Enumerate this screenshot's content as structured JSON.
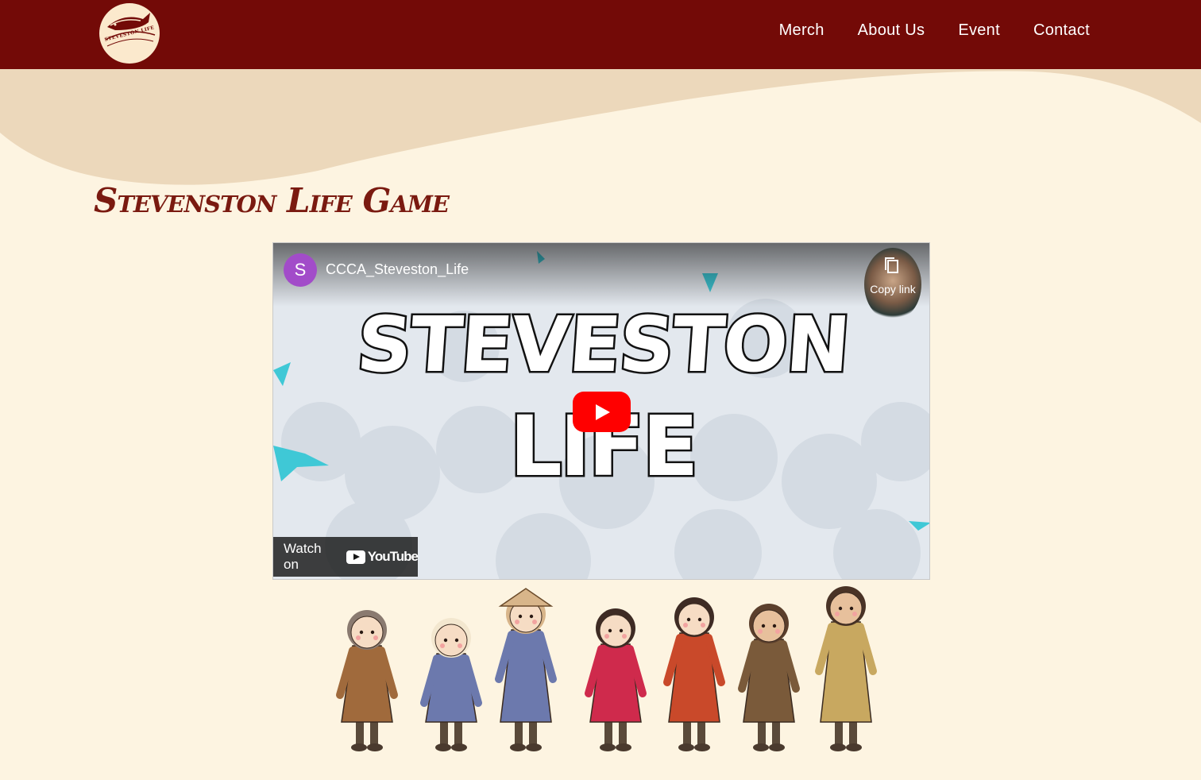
{
  "header": {
    "logo_text": "STEVESTON LIFE",
    "nav": [
      "Merch",
      "About Us",
      "Event",
      "Contact"
    ]
  },
  "page": {
    "title": "Stevenston Life Game"
  },
  "video": {
    "channel_initial": "S",
    "channel_name": "CCCA_Steveston_Life",
    "copy_link_label": "Copy link",
    "title_line1": "STEVESTON",
    "title_line2": "LIFE",
    "watch_on_label": "Watch on",
    "youtube_label": "YouTube"
  },
  "characters": [
    {
      "name": "fisherwoman-with-bucket-and-fish",
      "skin": "#f6dcc4",
      "hair": "#8a7a70",
      "outfit": "#a06a3c"
    },
    {
      "name": "woman-in-headscarf-blue-robe",
      "skin": "#f6dcc4",
      "hair": "#f3e7cf",
      "outfit": "#6c79ad"
    },
    {
      "name": "man-in-straw-hat-blue-robe",
      "skin": "#f6dcc4",
      "hair": "#d8b58a",
      "outfit": "#6c79ad"
    },
    {
      "name": "girl-in-red-qipao",
      "skin": "#f6dcc4",
      "hair": "#3e2b24",
      "outfit": "#cf2a4c"
    },
    {
      "name": "boy-in-red-tang-suit",
      "skin": "#f6dcc4",
      "hair": "#3e2b24",
      "outfit": "#c9492a"
    },
    {
      "name": "woman-in-vest-and-skirt",
      "skin": "#e7c09c",
      "hair": "#5b3f2c",
      "outfit": "#7a5a3a"
    },
    {
      "name": "indigenous-woman-in-cape",
      "skin": "#e7c09c",
      "hair": "#4a3326",
      "outfit": "#c8a860"
    }
  ],
  "colors": {
    "header_bg": "#730a07",
    "page_bg": "#fdf4e1",
    "wave": "#ecd8bb",
    "title": "#7a1a10",
    "play_button": "#ff0000"
  }
}
